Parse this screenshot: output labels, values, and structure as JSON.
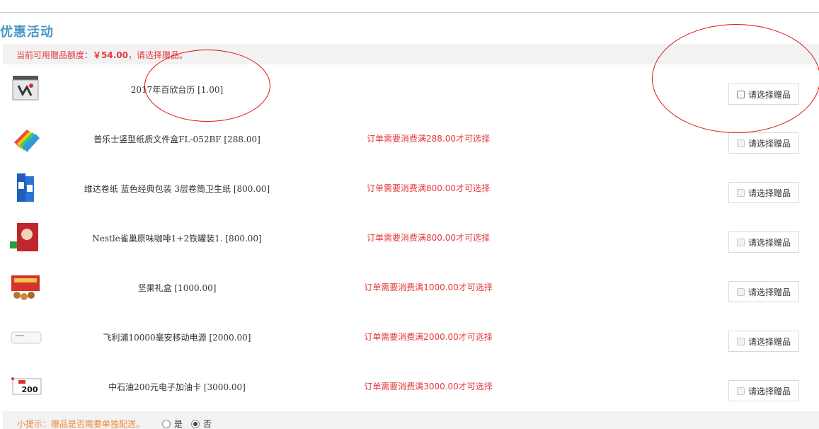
{
  "section": {
    "title": "优惠活动",
    "quota_prefix": "当前可用赠品额度：",
    "quota_amount": "￥54.00",
    "quota_suffix": "，请选择赠品。"
  },
  "gifts": [
    {
      "name": "2017年百欣台历 [1.00]",
      "condition": "",
      "button": "请选择赠品",
      "enabled": true
    },
    {
      "name": "普乐士竖型纸质文件盒FL-052BF [288.00]",
      "condition": "订单需要消费满288.00才可选择",
      "button": "请选择赠品",
      "enabled": false
    },
    {
      "name": "维达卷纸 蓝色经典包装 3层卷筒卫生纸 [800.00]",
      "condition": "订单需要消费满800.00才可选择",
      "button": "请选择赠品",
      "enabled": false
    },
    {
      "name": "Nestle雀巢原味咖啡1+2铁罐装1. [800.00]",
      "condition": "订单需要消费满800.00才可选择",
      "button": "请选择赠品",
      "enabled": false
    },
    {
      "name": "坚果礼盒 [1000.00]",
      "condition": "订单需要消费满1000.00才可选择",
      "button": "请选择赠品",
      "enabled": false
    },
    {
      "name": "飞利浦10000毫安移动电源 [2000.00]",
      "condition": "订单需要消费满2000.00才可选择",
      "button": "请选择赠品",
      "enabled": false
    },
    {
      "name": "中石油200元电子加油卡 [3000.00]",
      "condition": "订单需要消费满3000.00才可选择",
      "button": "请选择赠品",
      "enabled": false
    }
  ],
  "thumbs": {
    "card_value": "200"
  },
  "tip": {
    "label": "小提示：赠品是否需要单独配送。",
    "option_yes": "是",
    "option_no": "否",
    "selected": "否"
  },
  "colors": {
    "title": "#4a97c9",
    "price": "#e4393c",
    "tip": "#f08a3c",
    "annotation": "#e01010"
  }
}
